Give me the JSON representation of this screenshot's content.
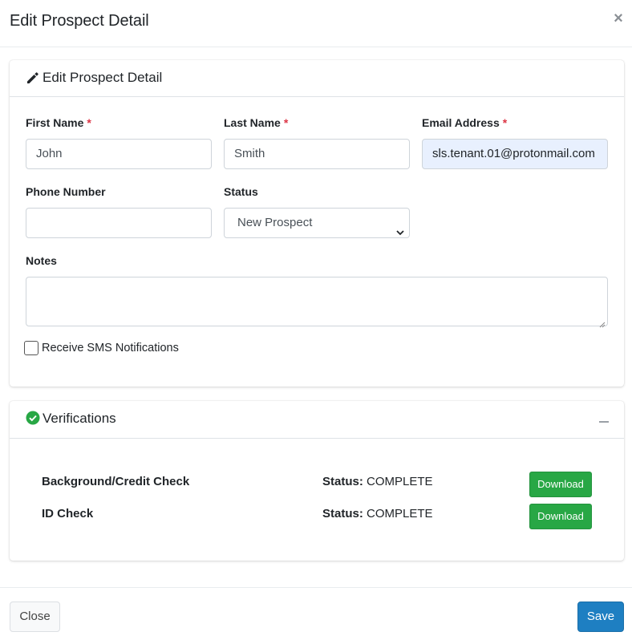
{
  "modal": {
    "title": "Edit Prospect Detail",
    "close_icon": "×"
  },
  "details_card": {
    "title": "Edit Prospect Detail",
    "icon": "pencil-icon",
    "first_name": {
      "label": "First Name",
      "required": "*",
      "value": "John"
    },
    "last_name": {
      "label": "Last Name",
      "required": "*",
      "value": "Smith"
    },
    "email": {
      "label": "Email Address",
      "required": "*",
      "value": "sls.tenant.01@protonmail.com"
    },
    "phone": {
      "label": "Phone Number",
      "value": ""
    },
    "status": {
      "label": "Status",
      "selected": "New Prospect"
    },
    "notes": {
      "label": "Notes",
      "value": ""
    },
    "sms": {
      "label": "Receive SMS Notifications",
      "checked": false
    }
  },
  "verifications_card": {
    "title": "Verifications",
    "icon": "check-circle-icon",
    "status_prefix": "Status:",
    "rows": [
      {
        "name": "Background/Credit Check",
        "status": "COMPLETE",
        "button": "Download"
      },
      {
        "name": "ID Check",
        "status": "COMPLETE",
        "button": "Download"
      }
    ]
  },
  "footer": {
    "close_label": "Close",
    "save_label": "Save"
  },
  "colors": {
    "required": "#dc3545",
    "success": "#28a745",
    "primary": "#1e7fc2",
    "autofill_bg": "#e8f0fe"
  }
}
